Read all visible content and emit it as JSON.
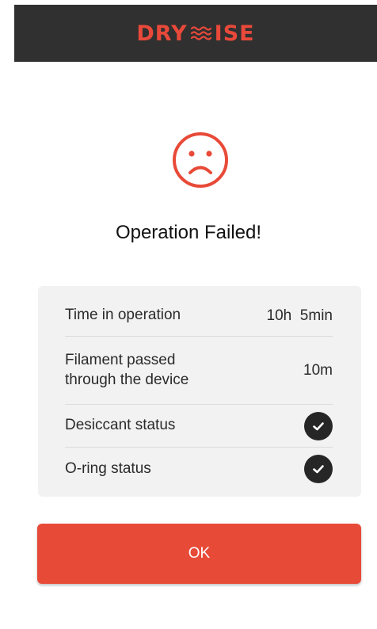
{
  "header": {
    "brand_left": "DRY",
    "brand_right": "ISE",
    "logo_icon": "wave-lines-icon",
    "brand_color": "#e8493a",
    "background": "#303030"
  },
  "status_icon": "sad-face-icon",
  "accent_color": "#e84a38",
  "title": "Operation Failed!",
  "stats": {
    "time_in_operation": {
      "label": "Time in operation",
      "value": "10h  5min"
    },
    "filament_passed": {
      "label": "Filament passed\nthrough the device",
      "value": "10m"
    },
    "desiccant_status": {
      "label": "Desiccant status",
      "icon": "check-circle-icon",
      "ok": true
    },
    "oring_status": {
      "label": "O-ring status",
      "icon": "check-circle-icon",
      "ok": true
    }
  },
  "ok_button": {
    "label": "OK"
  }
}
